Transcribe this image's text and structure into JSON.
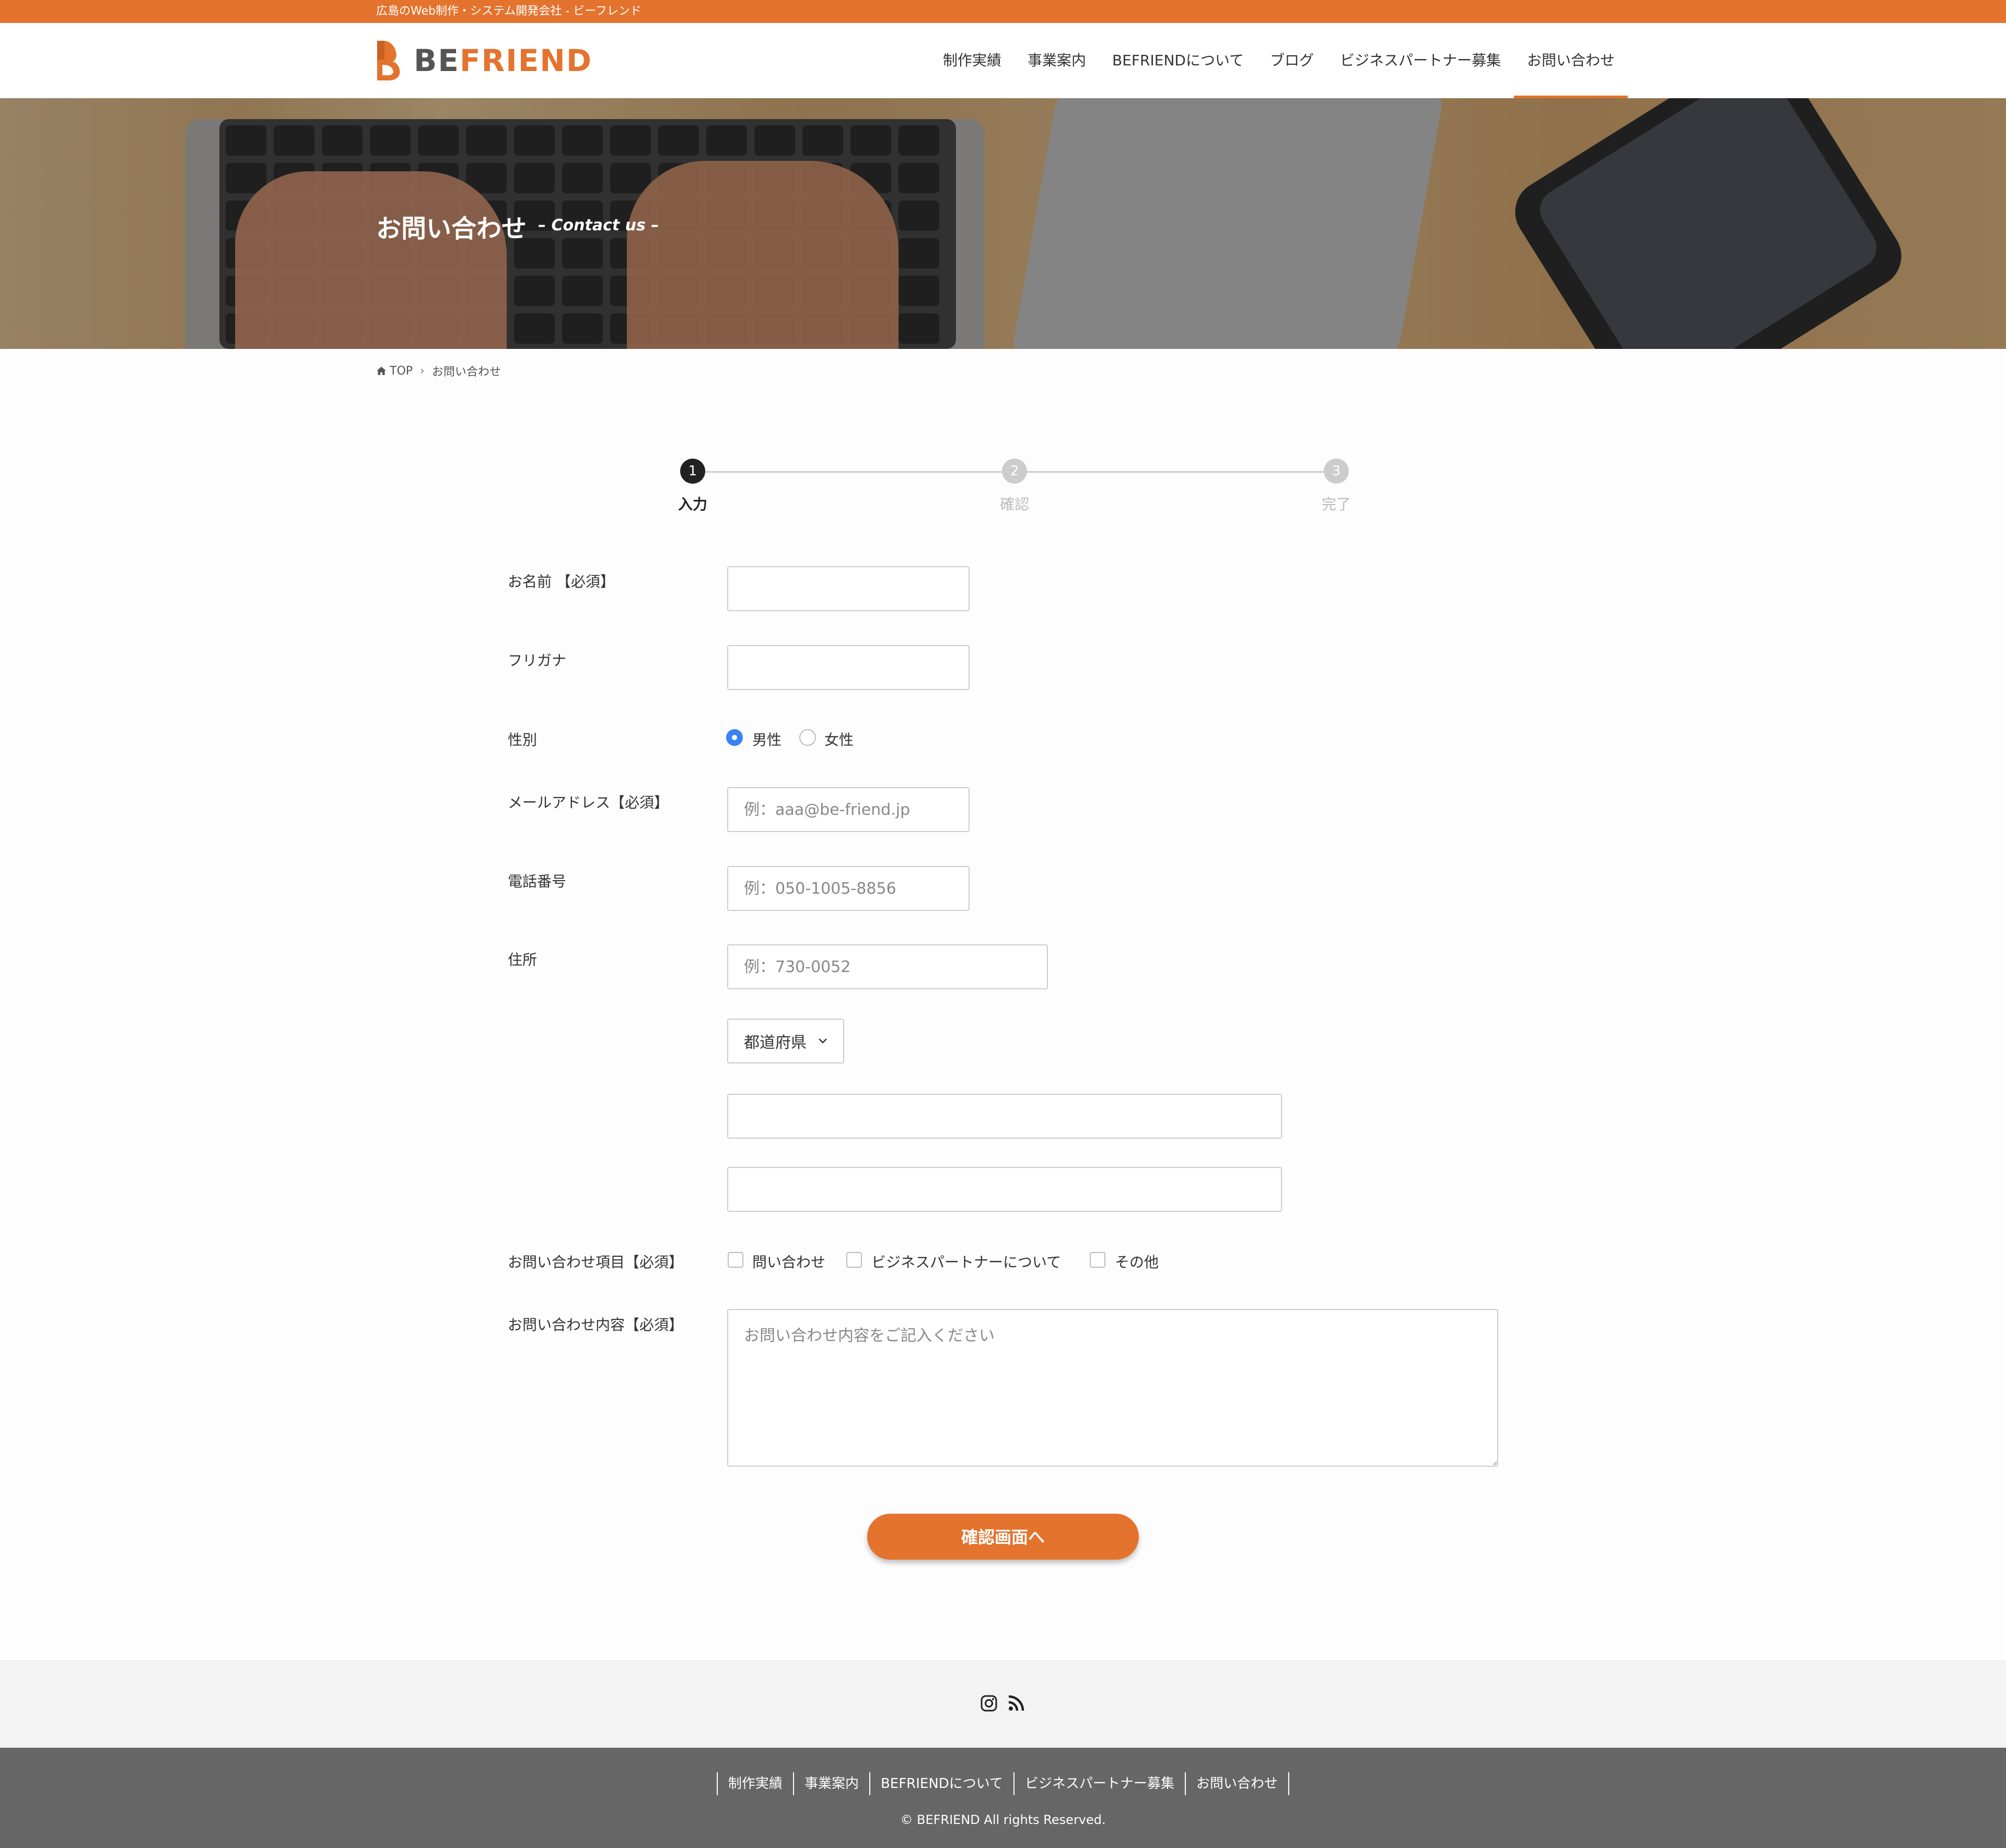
{
  "topbar": {
    "text": "広島のWeb制作・システム開発会社 - ビーフレンド"
  },
  "logo": {
    "be": "BE",
    "friend": "FRIEND"
  },
  "nav": {
    "items": [
      "制作実績",
      "事業案内",
      "BEFRIENDについて",
      "ブログ",
      "ビジネスパートナー募集",
      "お問い合わせ"
    ],
    "active": "お問い合わせ"
  },
  "hero": {
    "title": "お問い合わせ",
    "subtitle": "– Contact us –"
  },
  "breadcrumb": {
    "home": "TOP",
    "separator": "›",
    "current": "お問い合わせ"
  },
  "steps": [
    {
      "number": "1",
      "label": "入力",
      "active": true
    },
    {
      "number": "2",
      "label": "確認",
      "active": false
    },
    {
      "number": "3",
      "label": "完了",
      "active": false
    }
  ],
  "form": {
    "name": {
      "label": "お名前 【必須】",
      "value": "",
      "placeholder": ""
    },
    "kana": {
      "label": "フリガナ",
      "value": "",
      "placeholder": ""
    },
    "gender": {
      "label": "性別",
      "options": [
        "男性",
        "女性"
      ],
      "selected": "男性"
    },
    "email": {
      "label": "メールアドレス【必須】",
      "placeholder": "例：aaa@be-friend.jp"
    },
    "tel": {
      "label": "電話番号",
      "placeholder": "例：050-1005-8856"
    },
    "address": {
      "label": "住所",
      "zip_placeholder": "例：730-0052",
      "prefecture": "都道府県"
    },
    "inquiry_type": {
      "label": "お問い合わせ項目【必須】",
      "options": [
        "問い合わせ",
        "ビジネスパートナーについて",
        "その他"
      ]
    },
    "message": {
      "label": "お問い合わせ内容【必須】",
      "placeholder": "お問い合わせ内容をご記入ください"
    },
    "submit_label": "確認画面へ"
  },
  "footer": {
    "icons": [
      "instagram-icon",
      "rss-icon"
    ],
    "nav": [
      "制作実績",
      "事業案内",
      "BEFRIENDについて",
      "ビジネスパートナー募集",
      "お問い合わせ"
    ],
    "copyright": "© BEFRIEND All rights Reserved."
  },
  "colors": {
    "accent": "#e4732e",
    "radio": "#3b82f6",
    "footer_dark": "#666666",
    "footer_light": "#f3f3f3"
  }
}
